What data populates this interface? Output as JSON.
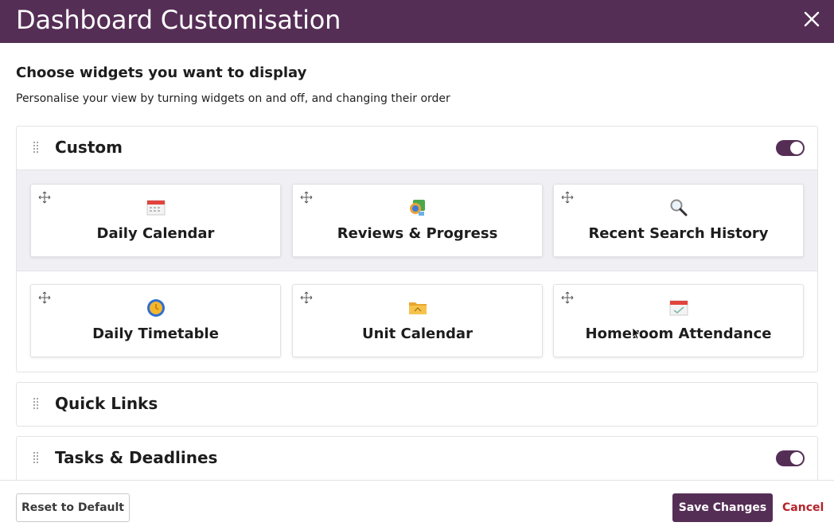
{
  "header": {
    "title": "Dashboard Customisation",
    "close_icon": "close-icon"
  },
  "intro": {
    "heading": "Choose widgets you want to display",
    "subheading": "Personalise your view by turning widgets on and off, and changing their order"
  },
  "sections": [
    {
      "title": "Custom",
      "enabled": true,
      "widgets": [
        {
          "label": "Daily Calendar",
          "icon": "calendar-icon"
        },
        {
          "label": "Reviews & Progress",
          "icon": "reviews-progress-icon"
        },
        {
          "label": "Recent Search History",
          "icon": "magnifier-icon"
        },
        {
          "label": "Daily Timetable",
          "icon": "clock-icon"
        },
        {
          "label": "Unit Calendar",
          "icon": "folder-icon"
        },
        {
          "label": "Homeroom Attendance",
          "icon": "attendance-calendar-icon"
        }
      ]
    },
    {
      "title": "Quick Links"
    },
    {
      "title": "Tasks & Deadlines",
      "enabled": true
    }
  ],
  "footer": {
    "reset_label": "Reset to Default",
    "save_label": "Save Changes",
    "cancel_label": "Cancel"
  },
  "colors": {
    "brand": "#552e56",
    "cancel": "#b4232a",
    "band": "#f0f0f4"
  }
}
